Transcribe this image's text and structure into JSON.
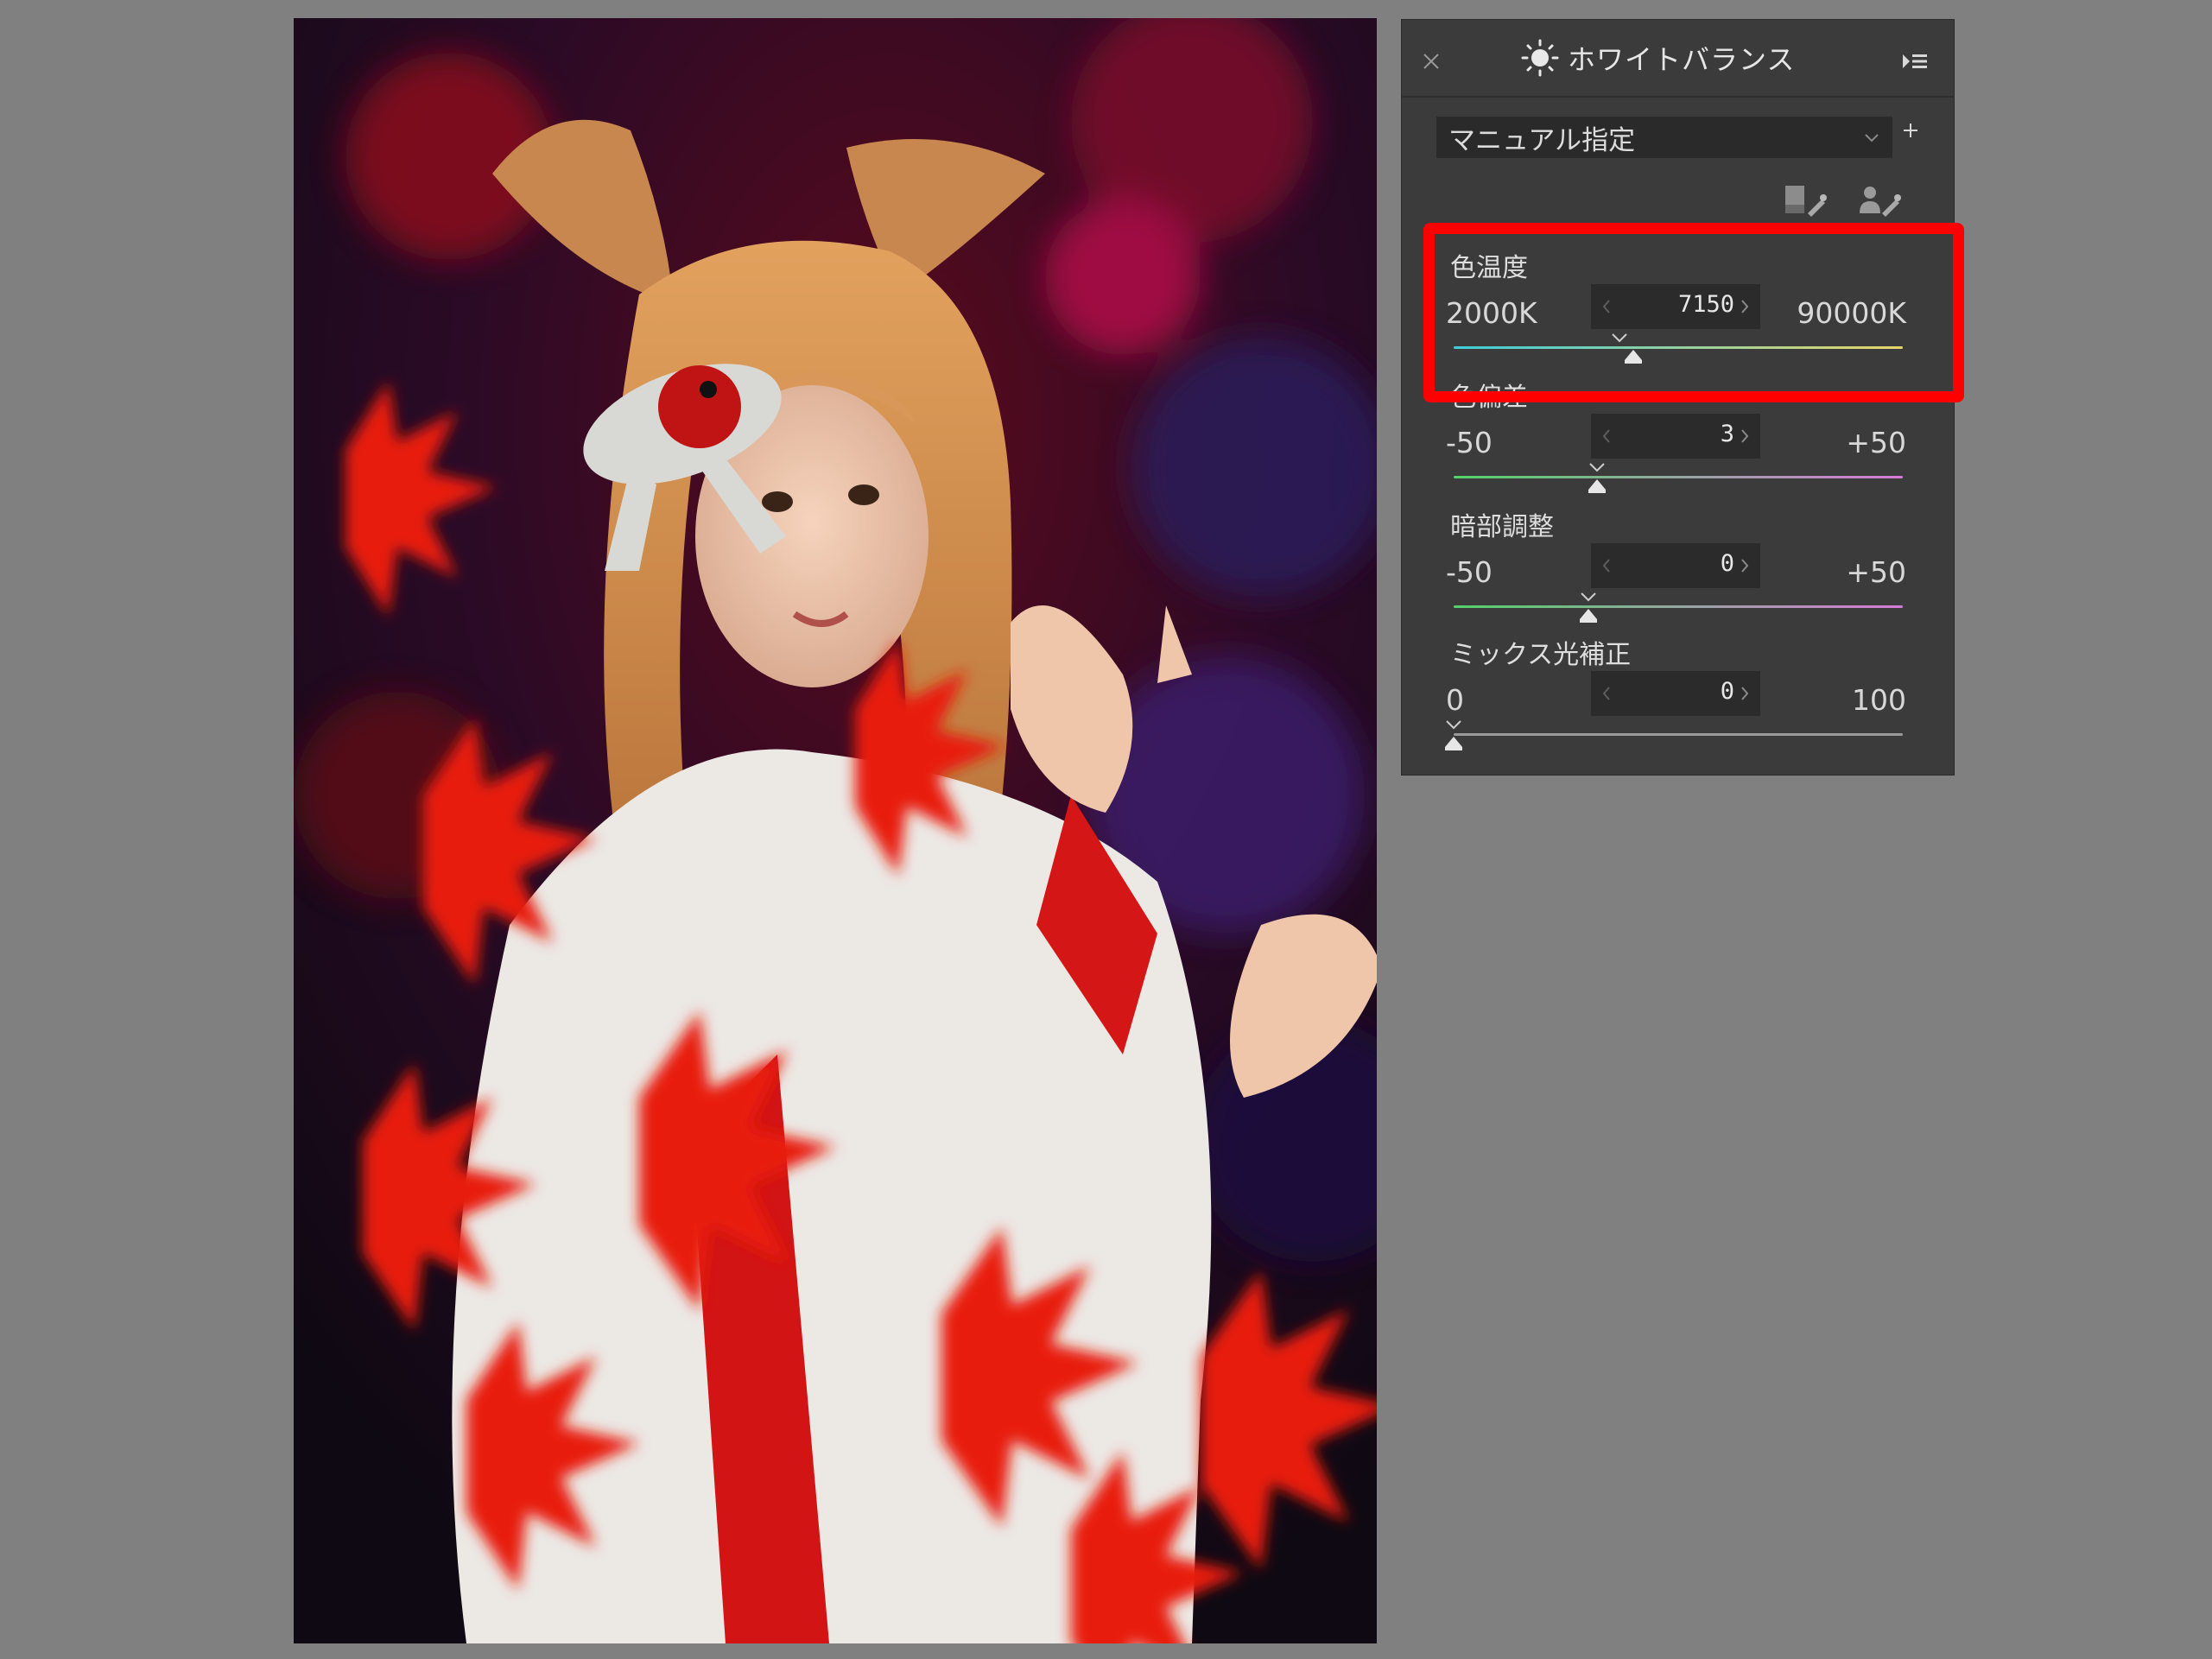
{
  "panel": {
    "title": "ホワイトバランス",
    "icons": {
      "close": "close-icon",
      "sun": "sun-icon",
      "menu": "panel-menu-icon",
      "plus": "plus-icon",
      "dropdown": "chevron-down-icon"
    },
    "preset": {
      "value": "マニュアル指定"
    },
    "eyedroppers": [
      "gray-point-eyedropper-icon",
      "skin-eyedropper-icon"
    ],
    "sliders": [
      {
        "id": "temperature",
        "title": "色温度",
        "min": "2000K",
        "max": "90000K",
        "value": "7150",
        "position": 0.4,
        "default_position": 0.37,
        "gradient": [
          "#3ecdd9",
          "#e7d56a"
        ],
        "highlighted": true
      },
      {
        "id": "tint",
        "title": "色偏差",
        "min": "-50",
        "max": "+50",
        "value": "3",
        "position": 0.32,
        "default_position": 0.32,
        "gradient": [
          "#52d26a",
          "#d67ad6"
        ]
      },
      {
        "id": "shadow",
        "title": "暗部調整",
        "min": "-50",
        "max": "+50",
        "value": "0",
        "position": 0.3,
        "default_position": 0.3,
        "gradient": [
          "#52d26a",
          "#d67ad6"
        ]
      },
      {
        "id": "mixed",
        "title": "ミックス光補正",
        "min": "0",
        "max": "100",
        "value": "0",
        "position": 0.0,
        "default_position": 0.0,
        "gradient": [
          "#9a9a9a",
          "#9a9a9a"
        ]
      }
    ]
  },
  "colors": {
    "background": "#808080",
    "panel": "#3b3b3b",
    "highlight": "#ff0000"
  }
}
